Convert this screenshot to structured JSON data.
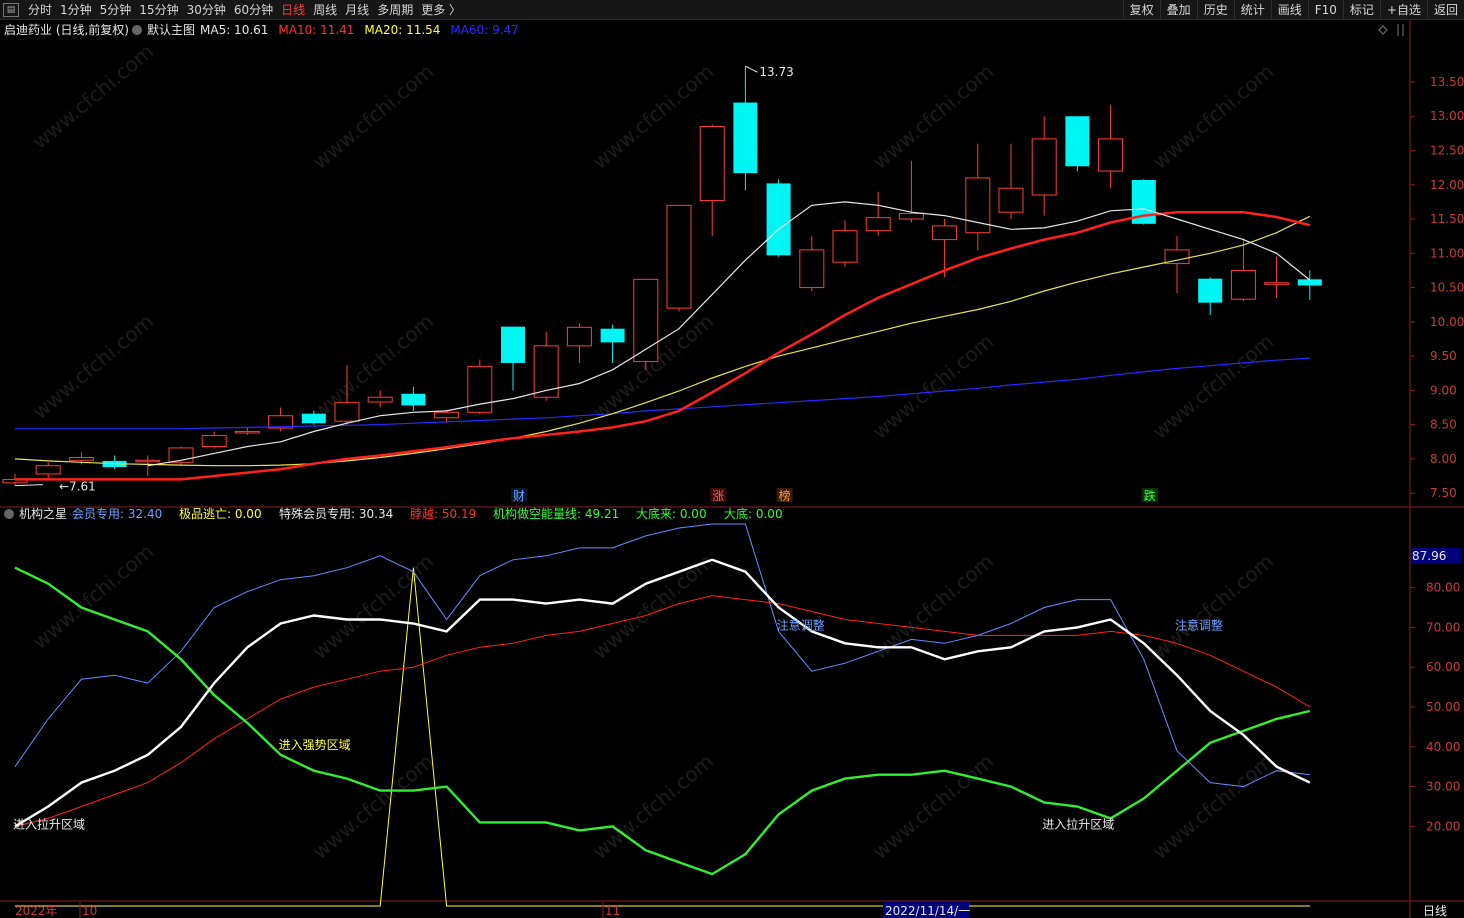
{
  "toolbar": {
    "periods": [
      "分时",
      "1分钟",
      "5分钟",
      "15分钟",
      "30分钟",
      "60分钟",
      "日线",
      "周线",
      "月线",
      "多周期",
      "更多 〉"
    ],
    "active_period": "日线",
    "right_buttons": [
      "复权",
      "叠加",
      "历史",
      "统计",
      "画线",
      "F10",
      "标记",
      "+自选",
      "返回"
    ]
  },
  "main_header": {
    "stock": "启迪药业 (日线,前复权)",
    "template": "默认主图",
    "ma": [
      {
        "label": "MA5:",
        "value": "10.61",
        "color": "#e8e8e8"
      },
      {
        "label": "MA10:",
        "value": "11.41",
        "color": "#ff3030"
      },
      {
        "label": "MA20:",
        "value": "11.54",
        "color": "#ffff33"
      },
      {
        "label": "MA60:",
        "value": "9.47",
        "color": "#2a2aff"
      }
    ]
  },
  "price_axis": {
    "ticks": [
      "13.50",
      "13.00",
      "12.50",
      "12.00",
      "11.50",
      "11.00",
      "10.50",
      "10.00",
      "9.50",
      "9.00",
      "8.50",
      "8.00",
      "7.50"
    ],
    "min": 7.4,
    "max": 13.85
  },
  "annotations": {
    "high": "13.73",
    "low": "7.61"
  },
  "event_markers": [
    {
      "text": "财",
      "color": "#6fa8ff",
      "bg": "#0a1630",
      "index": 15
    },
    {
      "text": "涨",
      "color": "#ff5a5a",
      "bg": "#3a0a0a",
      "index": 21
    },
    {
      "text": "榜",
      "color": "#ff9a3a",
      "bg": "#3a1a00",
      "index": 23
    },
    {
      "text": "跌",
      "color": "#44ff44",
      "bg": "#0a300a",
      "index": 34
    }
  ],
  "candles": [
    {
      "o": 7.65,
      "h": 7.78,
      "l": 7.61,
      "c": 7.7
    },
    {
      "o": 7.78,
      "h": 7.95,
      "l": 7.7,
      "c": 7.9
    },
    {
      "o": 7.98,
      "h": 8.1,
      "l": 7.92,
      "c": 8.02
    },
    {
      "o": 7.97,
      "h": 8.05,
      "l": 7.85,
      "c": 7.88
    },
    {
      "o": 7.98,
      "h": 8.05,
      "l": 7.75,
      "c": 7.98
    },
    {
      "o": 7.95,
      "h": 8.18,
      "l": 7.9,
      "c": 8.16
    },
    {
      "o": 8.18,
      "h": 8.4,
      "l": 8.15,
      "c": 8.34
    },
    {
      "o": 8.38,
      "h": 8.45,
      "l": 8.35,
      "c": 8.4
    },
    {
      "o": 8.45,
      "h": 8.75,
      "l": 8.4,
      "c": 8.63
    },
    {
      "o": 8.66,
      "h": 8.7,
      "l": 8.5,
      "c": 8.52
    },
    {
      "o": 8.55,
      "h": 9.37,
      "l": 8.5,
      "c": 8.82
    },
    {
      "o": 8.83,
      "h": 9.0,
      "l": 8.75,
      "c": 8.9
    },
    {
      "o": 8.95,
      "h": 9.05,
      "l": 8.7,
      "c": 8.78
    },
    {
      "o": 8.6,
      "h": 8.72,
      "l": 8.52,
      "c": 8.68
    },
    {
      "o": 8.68,
      "h": 9.45,
      "l": 8.65,
      "c": 9.35
    },
    {
      "o": 9.93,
      "h": 9.93,
      "l": 9.0,
      "c": 9.4
    },
    {
      "o": 8.9,
      "h": 9.85,
      "l": 8.85,
      "c": 9.65
    },
    {
      "o": 9.65,
      "h": 9.98,
      "l": 9.4,
      "c": 9.92
    },
    {
      "o": 9.9,
      "h": 9.96,
      "l": 9.4,
      "c": 9.7
    },
    {
      "o": 9.42,
      "h": 10.62,
      "l": 9.3,
      "c": 10.62
    },
    {
      "o": 10.2,
      "h": 11.7,
      "l": 10.15,
      "c": 11.7
    },
    {
      "o": 11.77,
      "h": 12.88,
      "l": 11.25,
      "c": 12.85
    },
    {
      "o": 13.2,
      "h": 13.73,
      "l": 11.92,
      "c": 12.17
    },
    {
      "o": 12.02,
      "h": 12.08,
      "l": 10.95,
      "c": 10.97
    },
    {
      "o": 10.5,
      "h": 11.25,
      "l": 10.45,
      "c": 11.05
    },
    {
      "o": 10.87,
      "h": 11.48,
      "l": 10.8,
      "c": 11.33
    },
    {
      "o": 11.33,
      "h": 11.9,
      "l": 11.25,
      "c": 11.52
    },
    {
      "o": 11.5,
      "h": 12.35,
      "l": 11.45,
      "c": 11.58
    },
    {
      "o": 11.2,
      "h": 11.5,
      "l": 10.65,
      "c": 11.4
    },
    {
      "o": 11.3,
      "h": 12.6,
      "l": 11.05,
      "c": 12.1
    },
    {
      "o": 11.6,
      "h": 12.6,
      "l": 11.5,
      "c": 11.95
    },
    {
      "o": 11.85,
      "h": 13.0,
      "l": 11.55,
      "c": 12.67
    },
    {
      "o": 13.0,
      "h": 13.0,
      "l": 12.2,
      "c": 12.27
    },
    {
      "o": 12.2,
      "h": 13.17,
      "l": 11.95,
      "c": 12.67
    },
    {
      "o": 12.07,
      "h": 12.08,
      "l": 11.42,
      "c": 11.43
    },
    {
      "o": 10.85,
      "h": 11.25,
      "l": 10.42,
      "c": 11.05
    },
    {
      "o": 10.63,
      "h": 10.65,
      "l": 10.1,
      "c": 10.28
    },
    {
      "o": 10.33,
      "h": 11.22,
      "l": 10.3,
      "c": 10.75
    },
    {
      "o": 10.57,
      "h": 10.95,
      "l": 10.35,
      "c": 10.57
    },
    {
      "o": 10.62,
      "h": 10.75,
      "l": 10.32,
      "c": 10.53
    }
  ],
  "ma_series": {
    "ma5": [
      null,
      null,
      null,
      null,
      7.9,
      7.98,
      8.08,
      8.18,
      8.25,
      8.4,
      8.52,
      8.63,
      8.68,
      8.7,
      8.8,
      8.88,
      9.0,
      9.1,
      9.3,
      9.6,
      9.9,
      10.4,
      10.9,
      11.35,
      11.7,
      11.75,
      11.7,
      11.6,
      11.55,
      11.45,
      11.35,
      11.37,
      11.47,
      11.62,
      11.65,
      11.5,
      11.35,
      11.2,
      11.0,
      10.61
    ],
    "ma10": [
      7.7,
      7.7,
      7.7,
      7.7,
      7.7,
      7.7,
      7.75,
      7.8,
      7.85,
      7.93,
      8.0,
      8.05,
      8.11,
      8.17,
      8.24,
      8.3,
      8.35,
      8.4,
      8.46,
      8.55,
      8.7,
      8.97,
      9.25,
      9.55,
      9.82,
      10.1,
      10.35,
      10.55,
      10.75,
      10.93,
      11.07,
      11.2,
      11.3,
      11.45,
      11.55,
      11.6,
      11.6,
      11.6,
      11.53,
      11.41
    ],
    "ma20": [
      8.0,
      7.97,
      7.95,
      7.93,
      7.92,
      7.91,
      7.9,
      7.9,
      7.91,
      7.93,
      7.97,
      8.02,
      8.08,
      8.15,
      8.22,
      8.3,
      8.4,
      8.52,
      8.66,
      8.82,
      8.99,
      9.18,
      9.35,
      9.5,
      9.62,
      9.74,
      9.86,
      9.98,
      10.08,
      10.18,
      10.3,
      10.45,
      10.58,
      10.7,
      10.8,
      10.9,
      11.0,
      11.12,
      11.3,
      11.54
    ],
    "ma60": [
      8.44,
      8.44,
      8.44,
      8.44,
      8.44,
      8.44,
      8.45,
      8.46,
      8.47,
      8.48,
      8.49,
      8.5,
      8.52,
      8.54,
      8.56,
      8.58,
      8.6,
      8.63,
      8.66,
      8.7,
      8.73,
      8.76,
      8.79,
      8.82,
      8.85,
      8.88,
      8.91,
      8.95,
      8.99,
      9.03,
      9.08,
      9.12,
      9.16,
      9.22,
      9.27,
      9.32,
      9.36,
      9.4,
      9.44,
      9.47
    ]
  },
  "indicator_header": {
    "name": "机构之星",
    "items": [
      {
        "label": "会员专用:",
        "value": "32.40",
        "color": "#6fa0ff"
      },
      {
        "label": "极品逃亡:",
        "value": "0.00",
        "color": "#ffff33"
      },
      {
        "label": "特殊会员专用:",
        "value": "30.34",
        "color": "#e8e8e8"
      },
      {
        "label": "脖越:",
        "value": "50.19",
        "color": "#ff3030"
      },
      {
        "label": "机构做空能量线:",
        "value": "49.21",
        "color": "#33ff33"
      },
      {
        "label": "大底来:",
        "value": "0.00",
        "color": "#33ff33"
      },
      {
        "label": "大底:",
        "value": "0.00",
        "color": "#33ff33"
      }
    ]
  },
  "indicator_axis": {
    "ticks": [
      "80.00",
      "70.00",
      "60.00",
      "50.00",
      "40.00",
      "30.00",
      "20.00"
    ],
    "current": "87.96",
    "min": 2,
    "max": 97
  },
  "indicator_series": {
    "blue": [
      35,
      47,
      57,
      58,
      56,
      64,
      75,
      79,
      82,
      83,
      85,
      88,
      84,
      72,
      83,
      87,
      88,
      90,
      90,
      93,
      95,
      96,
      96,
      69,
      59,
      61,
      64,
      67,
      66,
      68,
      71,
      75,
      77,
      77,
      62,
      39,
      31,
      30,
      34,
      33
    ],
    "white": [
      20,
      25,
      31,
      34,
      38,
      45,
      56,
      65,
      71,
      73,
      72,
      72,
      71,
      69,
      77,
      77,
      76,
      77,
      76,
      81,
      84,
      87,
      84,
      75,
      69,
      66,
      65,
      65,
      62,
      64,
      65,
      69,
      70,
      72,
      66,
      58,
      49,
      43,
      35,
      31
    ],
    "red": [
      20,
      22,
      25,
      28,
      31,
      36,
      42,
      47,
      52,
      55,
      57,
      59,
      60,
      63,
      65,
      66,
      68,
      69,
      71,
      73,
      76,
      78,
      77,
      76,
      74,
      72,
      71,
      70,
      69,
      68,
      68,
      68,
      68,
      69,
      68,
      66,
      63,
      59,
      55,
      50
    ],
    "green": [
      85,
      81,
      75,
      72,
      69,
      62,
      53,
      46,
      38,
      34,
      32,
      29,
      29,
      30,
      21,
      21,
      21,
      19,
      20,
      14,
      11,
      8,
      13,
      23,
      29,
      32,
      33,
      33,
      34,
      32,
      30,
      26,
      25,
      22,
      27,
      34,
      41,
      44,
      47,
      49
    ],
    "yellow": [
      0,
      0,
      0,
      0,
      0,
      0,
      0,
      0,
      0,
      0,
      0,
      0,
      85,
      0,
      0,
      0,
      0,
      0,
      0,
      0,
      0,
      0,
      0,
      0,
      0,
      0,
      0,
      0,
      0,
      0,
      0,
      0,
      0,
      0,
      0,
      0,
      0,
      0,
      0,
      0
    ]
  },
  "indicator_labels": [
    {
      "text": "进入拉升区域",
      "index": 0,
      "value": 20,
      "color": "#e8e8e8"
    },
    {
      "text": "进入强势区域",
      "index": 8,
      "value": 40,
      "color": "#ffff33"
    },
    {
      "text": "注意调整",
      "index": 23,
      "value": 70,
      "color": "#6fa0ff"
    },
    {
      "text": "注意调整",
      "index": 35,
      "value": 70,
      "color": "#6fa0ff"
    },
    {
      "text": "进入拉升区域",
      "index": 31,
      "value": 20,
      "color": "#e8e8e8"
    }
  ],
  "date_axis": {
    "items": [
      "2022年",
      "10",
      "11"
    ],
    "highlight": "2022/11/14/一",
    "period": "日线"
  },
  "watermark": "www.cfchi.com"
}
